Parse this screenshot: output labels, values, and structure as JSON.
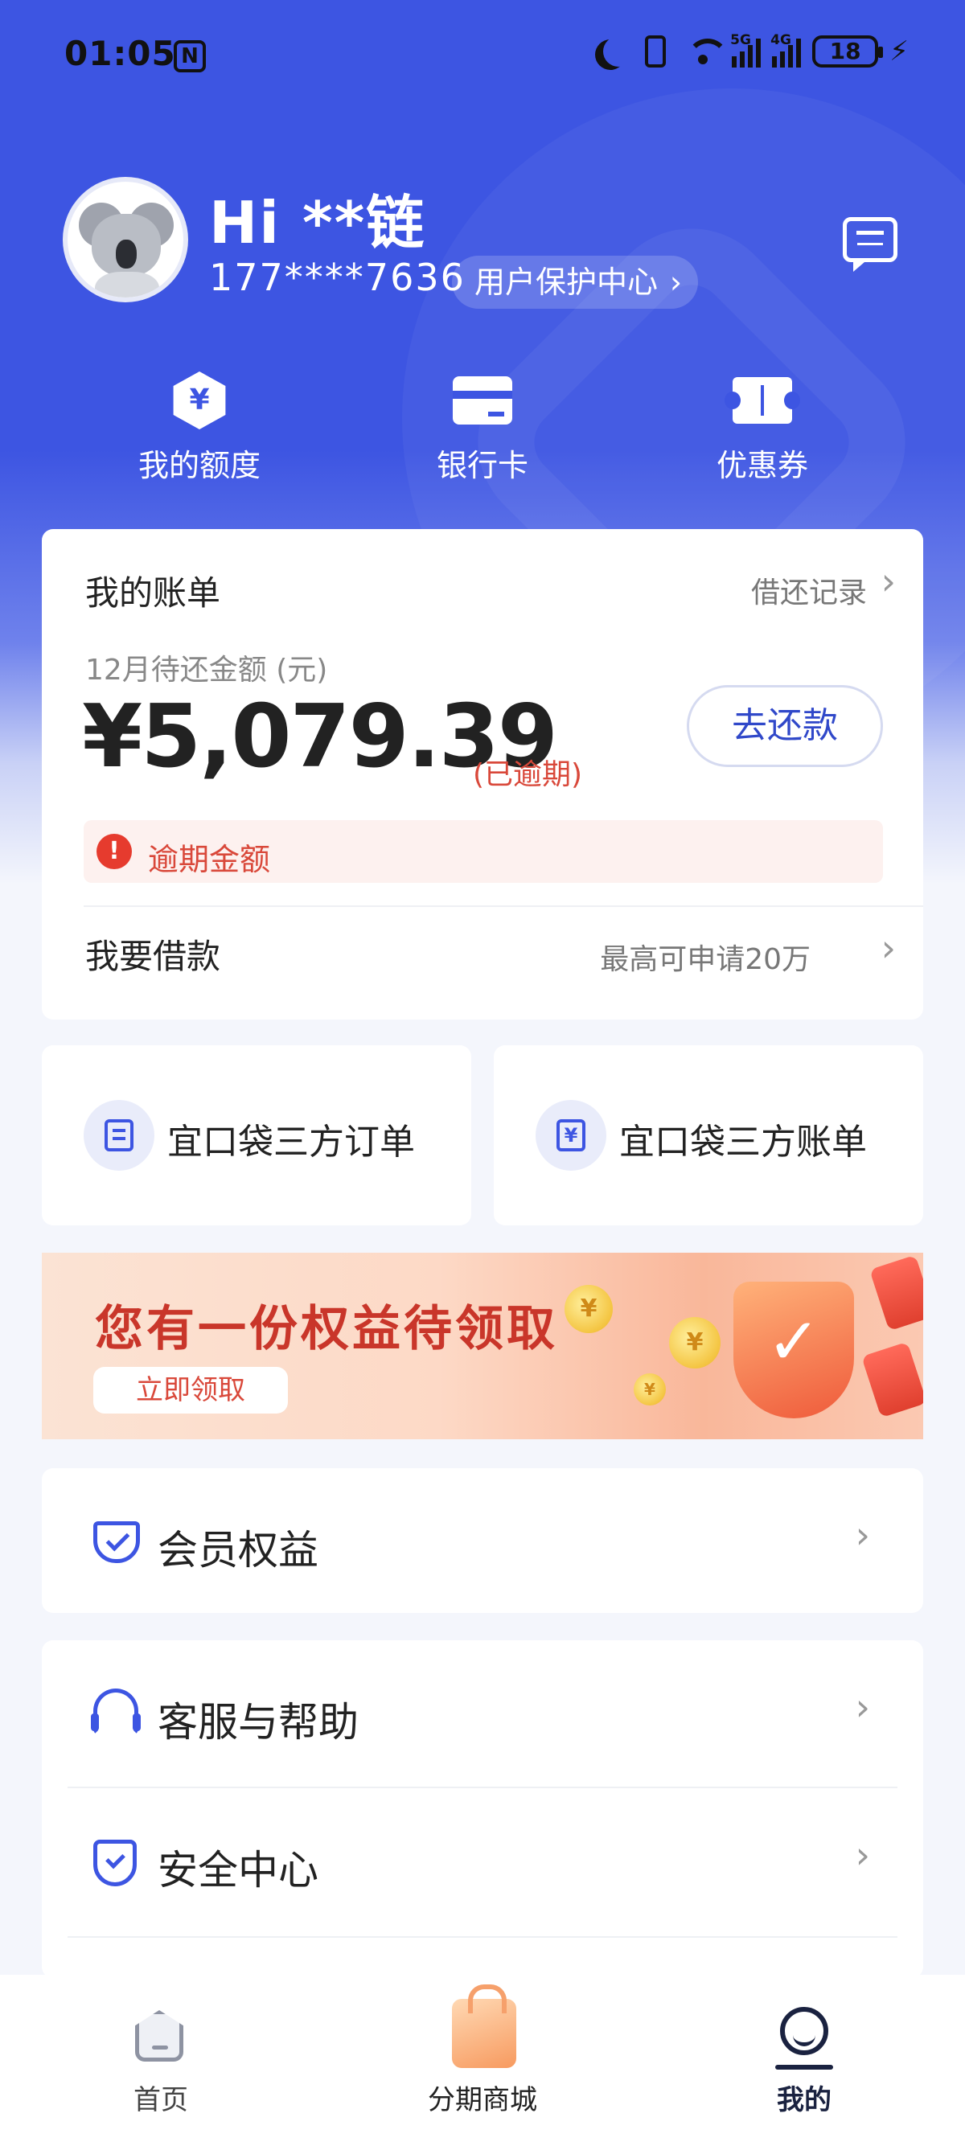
{
  "status_bar": {
    "time": "01:05",
    "nfc": "N",
    "network_1": "5G",
    "network_2": "4G",
    "battery": "18",
    "wifi_tag": "6"
  },
  "profile": {
    "greeting": "Hi **链",
    "phone": "177****7636",
    "protect_center": "用户保护中心"
  },
  "quick_actions": [
    {
      "label": "我的额度",
      "icon": "yen-hexagon-icon"
    },
    {
      "label": "银行卡",
      "icon": "bank-card-icon"
    },
    {
      "label": "优惠券",
      "icon": "coupon-icon"
    }
  ],
  "bill": {
    "title": "我的账单",
    "record_link": "借还记录",
    "subtitle": "12月待还金额 (元)",
    "amount": "¥5,079.39",
    "status": "(已逾期)",
    "pay_button": "去还款",
    "overdue_label": "逾期金额",
    "loan_title": "我要借款",
    "loan_max": "最高可申请20万"
  },
  "orders": [
    {
      "label": "宜口袋三方订单",
      "icon": "order-doc-icon"
    },
    {
      "label": "宜口袋三方账单",
      "icon": "bill-yen-icon"
    }
  ],
  "banner": {
    "title": "您有一份权益待领取",
    "button": "立即领取"
  },
  "menu": [
    {
      "label": "会员权益",
      "icon": "member-badge-icon"
    },
    {
      "label": "客服与帮助",
      "icon": "headset-icon"
    },
    {
      "label": "安全中心",
      "icon": "shield-check-icon"
    }
  ],
  "bottom_nav": [
    {
      "label": "首页",
      "icon": "home-icon",
      "active": false
    },
    {
      "label": "分期商城",
      "icon": "shopping-bag-icon",
      "active": false
    },
    {
      "label": "我的",
      "icon": "profile-icon",
      "active": true
    }
  ],
  "colors": {
    "brand_blue": "#3d55e2",
    "alert_red": "#d9483a",
    "text_dark": "#222222"
  }
}
